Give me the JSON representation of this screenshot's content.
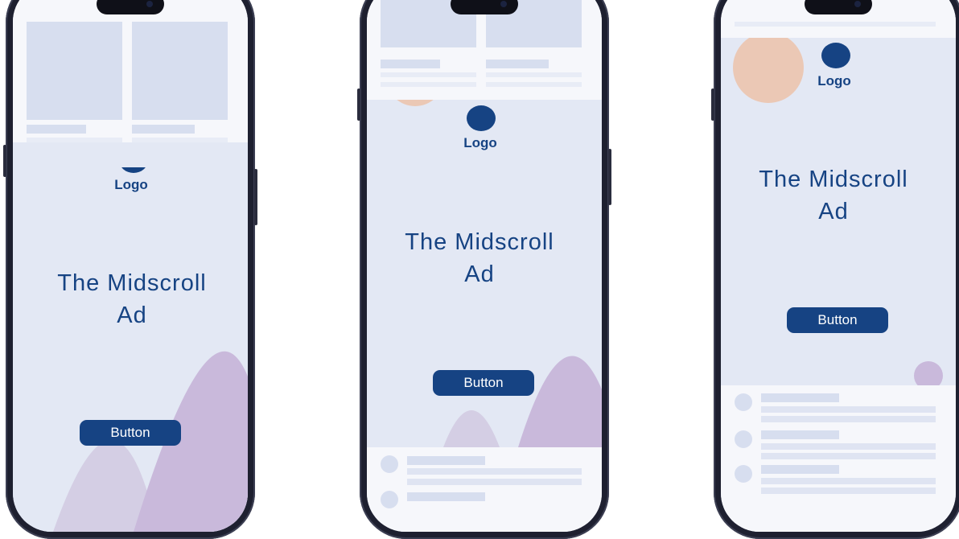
{
  "colors": {
    "accent": "#164383",
    "ad_background": "#e3e8f4",
    "feed_background": "#f6f7fb",
    "skeleton": "#d7deef",
    "mountain": "#c9b9db",
    "circle": "#ebc8b5"
  },
  "phones": [
    {
      "ad": {
        "logo_label": "Logo",
        "headline_line1": "The Midscroll",
        "headline_line2": "Ad",
        "button_label": "Button"
      }
    },
    {
      "ad": {
        "logo_label": "Logo",
        "headline_line1": "The Midscroll",
        "headline_line2": "Ad",
        "button_label": "Button"
      }
    },
    {
      "ad": {
        "logo_label": "Logo",
        "headline_line1": "The Midscroll",
        "headline_line2": "Ad",
        "button_label": "Button"
      }
    }
  ]
}
